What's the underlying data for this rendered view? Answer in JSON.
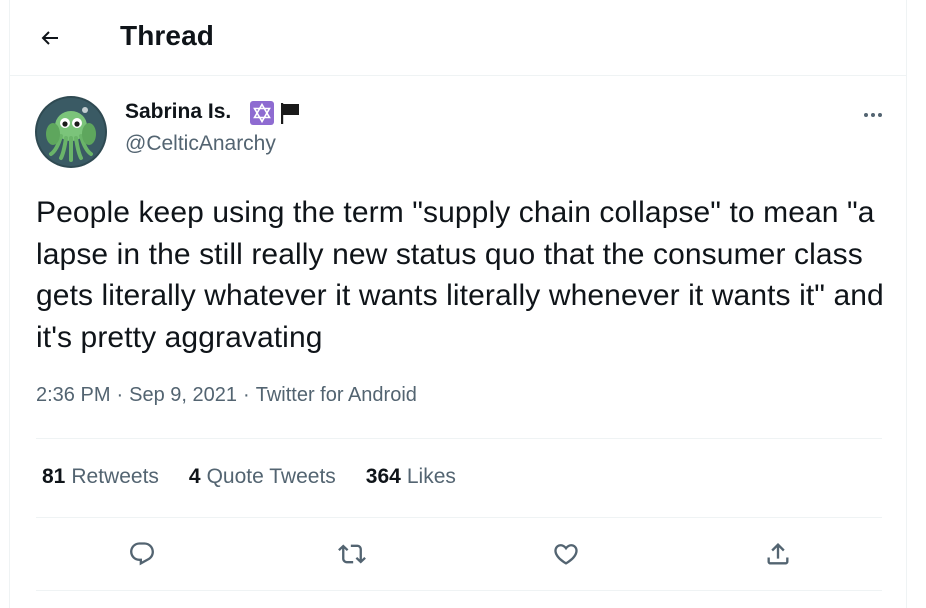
{
  "header": {
    "title": "Thread",
    "back_icon": "arrow-left-icon"
  },
  "tweet": {
    "author": {
      "display_name": "Sabrina Is.",
      "handle": "@CelticAnarchy",
      "badges": [
        "star-of-david-icon",
        "black-flag-icon"
      ],
      "avatar": "cthulhu-avatar"
    },
    "text": "People keep using the term \"supply chain collapse\" to mean \"a lapse in the still really new status quo that the consumer class gets literally whatever it wants literally whenever it wants it\" and it's pretty aggravating",
    "time": "2:36 PM",
    "date": "Sep 9, 2021",
    "source": "Twitter for Android",
    "separator": "·",
    "stats": {
      "retweets_count": "81",
      "retweets_label": "Retweets",
      "quotes_count": "4",
      "quotes_label": "Quote Tweets",
      "likes_count": "364",
      "likes_label": "Likes"
    },
    "actions": [
      "reply-icon",
      "retweet-icon",
      "like-icon",
      "share-icon"
    ]
  },
  "colors": {
    "text_primary": "#0f1419",
    "text_secondary": "#536471",
    "border": "#eff3f4",
    "badge_purple": "#8e6bd1"
  }
}
